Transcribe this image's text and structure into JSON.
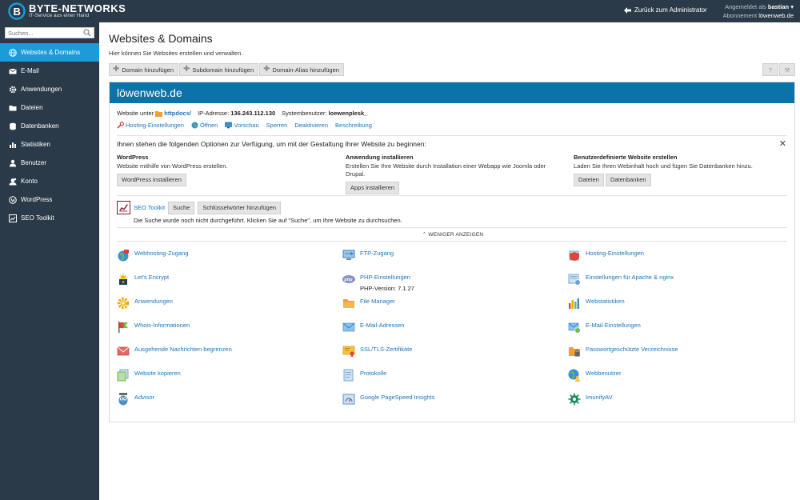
{
  "topbar": {
    "logo_title": "BYTE-NETWORKS",
    "logo_sub": "IT-Service aus einer Hand",
    "back_label": "Zurück zum Administrator",
    "logged_in_label": "Angemeldet als",
    "user_name": "bastian",
    "subscription_label": "Abonnement",
    "subscription_value": "löwenweb.de"
  },
  "sidebar": {
    "search_placeholder": "Suchen...",
    "items": [
      {
        "label": "Websites & Domains",
        "icon": "globe-icon",
        "active": true
      },
      {
        "label": "E-Mail",
        "icon": "mail-icon"
      },
      {
        "label": "Anwendungen",
        "icon": "gear-icon"
      },
      {
        "label": "Dateien",
        "icon": "folder-icon"
      },
      {
        "label": "Datenbanken",
        "icon": "database-icon"
      },
      {
        "label": "Statistiken",
        "icon": "bar-chart-icon"
      },
      {
        "label": "Benutzer",
        "icon": "user-icon"
      },
      {
        "label": "Konto",
        "icon": "account-icon"
      },
      {
        "label": "WordPress",
        "icon": "wordpress-icon"
      },
      {
        "label": "SEO Toolkit",
        "icon": "seo-chart-icon"
      }
    ]
  },
  "main": {
    "title": "Websites & Domains",
    "description": "Hier können Sie Websites erstellen und verwalten.",
    "toolbar": [
      "Domain hinzufügen",
      "Subdomain hinzufügen",
      "Domain-Alias hinzufügen"
    ],
    "help_symbol": "?",
    "settings_symbol": "⚒"
  },
  "domain": {
    "name": "löwenweb.de",
    "website_label": "Website unter",
    "docroot": "httpdocs/",
    "ip_label": "IP-Adresse:",
    "ip_value": "136.243.112.130",
    "sysuser_label": "Systembenutzer:",
    "sysuser_value": "loewenplesk_",
    "actions": [
      "Hosting-Einstellungen",
      "Öffnen",
      "Vorschau",
      "Sperren",
      "Deaktivieren",
      "Beschreibung"
    ]
  },
  "getting_started": {
    "intro": "Ihnen stehen die folgenden Optionen zur Verfügung, um mit der Gestaltung Ihrer Website zu beginnen:",
    "close_symbol": "✕",
    "wordpress": {
      "title": "WordPress",
      "desc": "Website mithilfe von WordPress erstellen.",
      "button": "WordPress installieren"
    },
    "apps": {
      "title": "Anwendung installieren",
      "desc": "Erstellen Sie Ihre Website durch Installation einer Webapp wie Joomla oder Drupal.",
      "button": "Apps installieren"
    },
    "custom": {
      "title": "Benutzerdefinierte Website erstellen",
      "desc": "Laden Sie Ihren Webinhalt hoch und fügen Sie Datenbanken hinzu.",
      "button_files": "Dateien",
      "button_db": "Datenbanken"
    }
  },
  "seo": {
    "link": "SEO Toolkit",
    "search_button": "Suche",
    "keywords_button": "Schlüsselwörter hinzufügen",
    "message": "Die Suche wurde noch nicht durchgeführt. Klicken Sie auf \"Suche\", um Ihre Website zu durchsuchen."
  },
  "less_toggle": "⌃ WENIGER ANZEIGEN",
  "tools": [
    [
      "Webhosting-Zugang",
      "FTP-Zugang",
      "Hosting-Einstellungen"
    ],
    [
      "Let's Encrypt",
      "PHP-Einstellungen",
      "Einstellungen für Apache & nginx"
    ],
    [
      "Anwendungen",
      "File Manager",
      "Webstatistiken"
    ],
    [
      "Whois-Informationen",
      "E-Mail-Adressen",
      "E-Mail-Einstellungen"
    ],
    [
      "Ausgehende Nachrichten begrenzen",
      "SSL/TLS-Zertifikate",
      "Passwortgeschützte Verzeichnisse"
    ],
    [
      "Website kopieren",
      "Protokolle",
      "Webbenutzer"
    ],
    [
      "Advisor",
      "Google PageSpeed Insights",
      "ImunifyAV"
    ]
  ],
  "php_version": "PHP-Version: 7.1.27",
  "colors": {
    "topbar": "#2b3a48",
    "accent": "#1b9bd7",
    "domain_header": "#0b73a8",
    "link": "#1b75bb"
  }
}
